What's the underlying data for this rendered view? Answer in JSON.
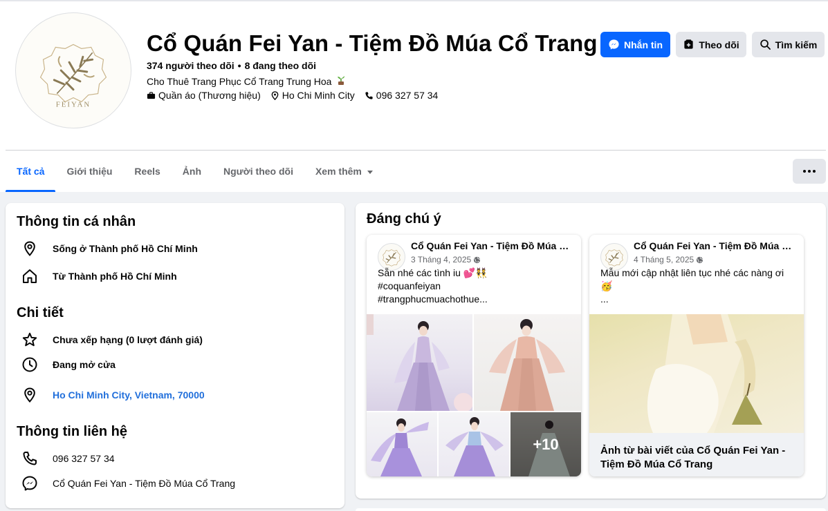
{
  "page": {
    "title": "Cổ Quán Fei Yan - Tiệm Đồ Múa Cổ Trang",
    "avatar_text": "FEIYAN",
    "followers": "374 người theo dõi",
    "following": "8 đang theo dõi",
    "tagline": "Cho Thuê Trang Phục Cổ Trang Trung Hoa",
    "category": "Quần áo (Thương hiệu)",
    "location": "Ho Chi Minh City",
    "phone": "096 327 57 34"
  },
  "actions": {
    "message": "Nhắn tin",
    "follow": "Theo dõi",
    "search": "Tìm kiếm"
  },
  "tabs": [
    {
      "label": "Tất cả",
      "active": true
    },
    {
      "label": "Giới thiệu"
    },
    {
      "label": "Reels"
    },
    {
      "label": "Ảnh"
    },
    {
      "label": "Người theo dõi"
    },
    {
      "label": "Xem thêm"
    }
  ],
  "about": {
    "personal_title": "Thông tin cá nhân",
    "lives_in": "Sống ở Thành phố Hồ Chí Minh",
    "from": "Từ Thành phố Hồ Chí Minh",
    "details_title": "Chi tiết",
    "rating": "Chưa xếp hạng (0 lượt đánh giá)",
    "open_status": "Đang mở cửa",
    "address": "Ho Chi Minh City, Vietnam, 70000",
    "contact_title": "Thông tin liên hệ",
    "contact_phone": "096 327 57 34",
    "contact_messenger": "Cổ Quán Fei Yan - Tiệm Đồ Múa Cổ Trang"
  },
  "featured": {
    "title": "Đáng chú ý",
    "posts": [
      {
        "author": "Cổ Quán Fei Yan - Tiệm Đồ Múa Cổ Trang",
        "date": "3 Tháng 4, 2025",
        "line1": "Sẵn nhé các tình iu 💕👯",
        "line2": "#coquanfeiyan",
        "line3": "#trangphucmuachothue...",
        "more_photos": "+10"
      },
      {
        "author": "Cổ Quán Fei Yan - Tiệm Đồ Múa Cổ Trang",
        "date": "4 Tháng 5, 2025",
        "line1": "Mẫu mới cập nhật liên tục nhé các nàng ơi",
        "line2": "🥳",
        "line3": "...",
        "footer": "Ảnh từ bài viết của Cổ Quán Fei Yan - Tiệm Đồ Múa Cổ Trang"
      }
    ]
  },
  "colors": {
    "accent": "#0866ff",
    "link": "#216fdb",
    "secondary_text": "#65676b",
    "button_gray": "#e4e6eb"
  }
}
